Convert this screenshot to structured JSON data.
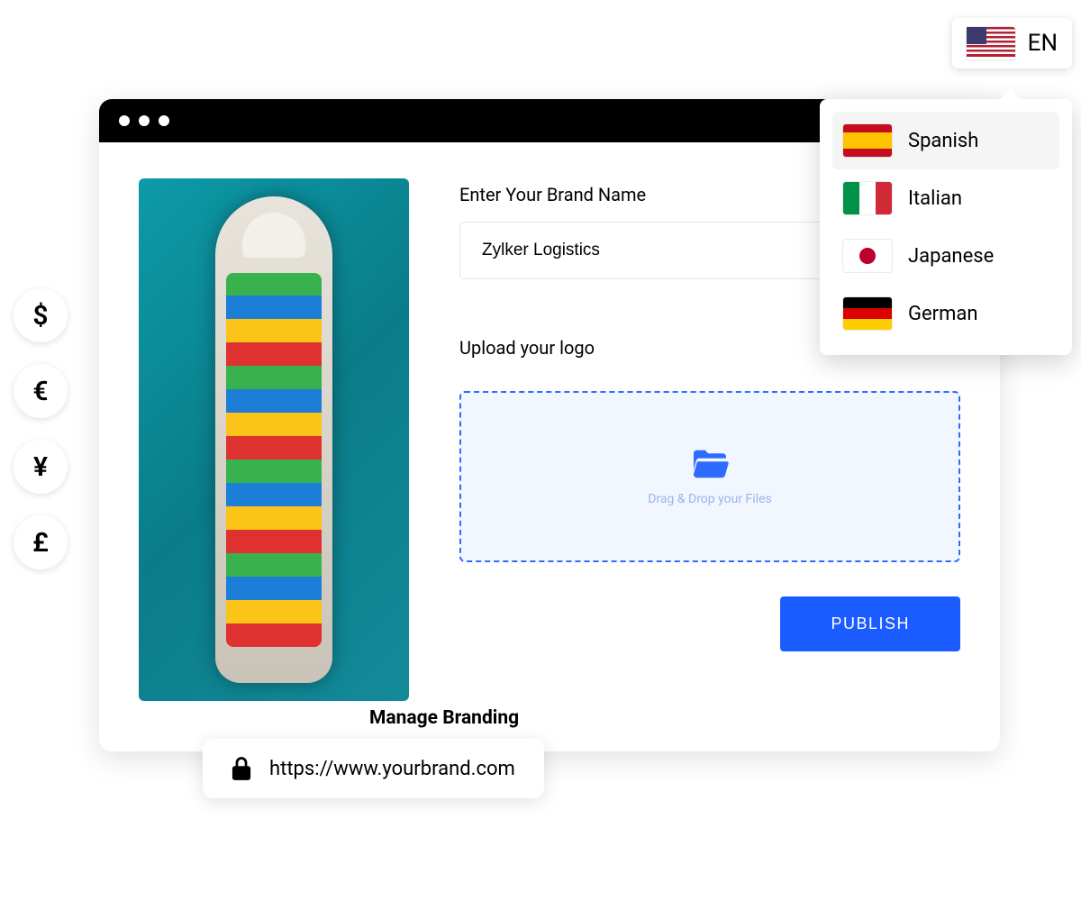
{
  "currencies": [
    "$",
    "€",
    "¥",
    "£"
  ],
  "form": {
    "brand_label": "Enter Your Brand Name",
    "brand_value": "Zylker Logistics",
    "upload_label": "Upload your logo",
    "dropzone_text": "Drag & Drop your Files",
    "publish_label": "PUBLISH"
  },
  "caption": "Manage Branding",
  "url": "https://www.yourbrand.com",
  "language_selector": {
    "active_code": "EN",
    "options": [
      "Spanish",
      "Italian",
      "Japanese",
      "German"
    ]
  }
}
